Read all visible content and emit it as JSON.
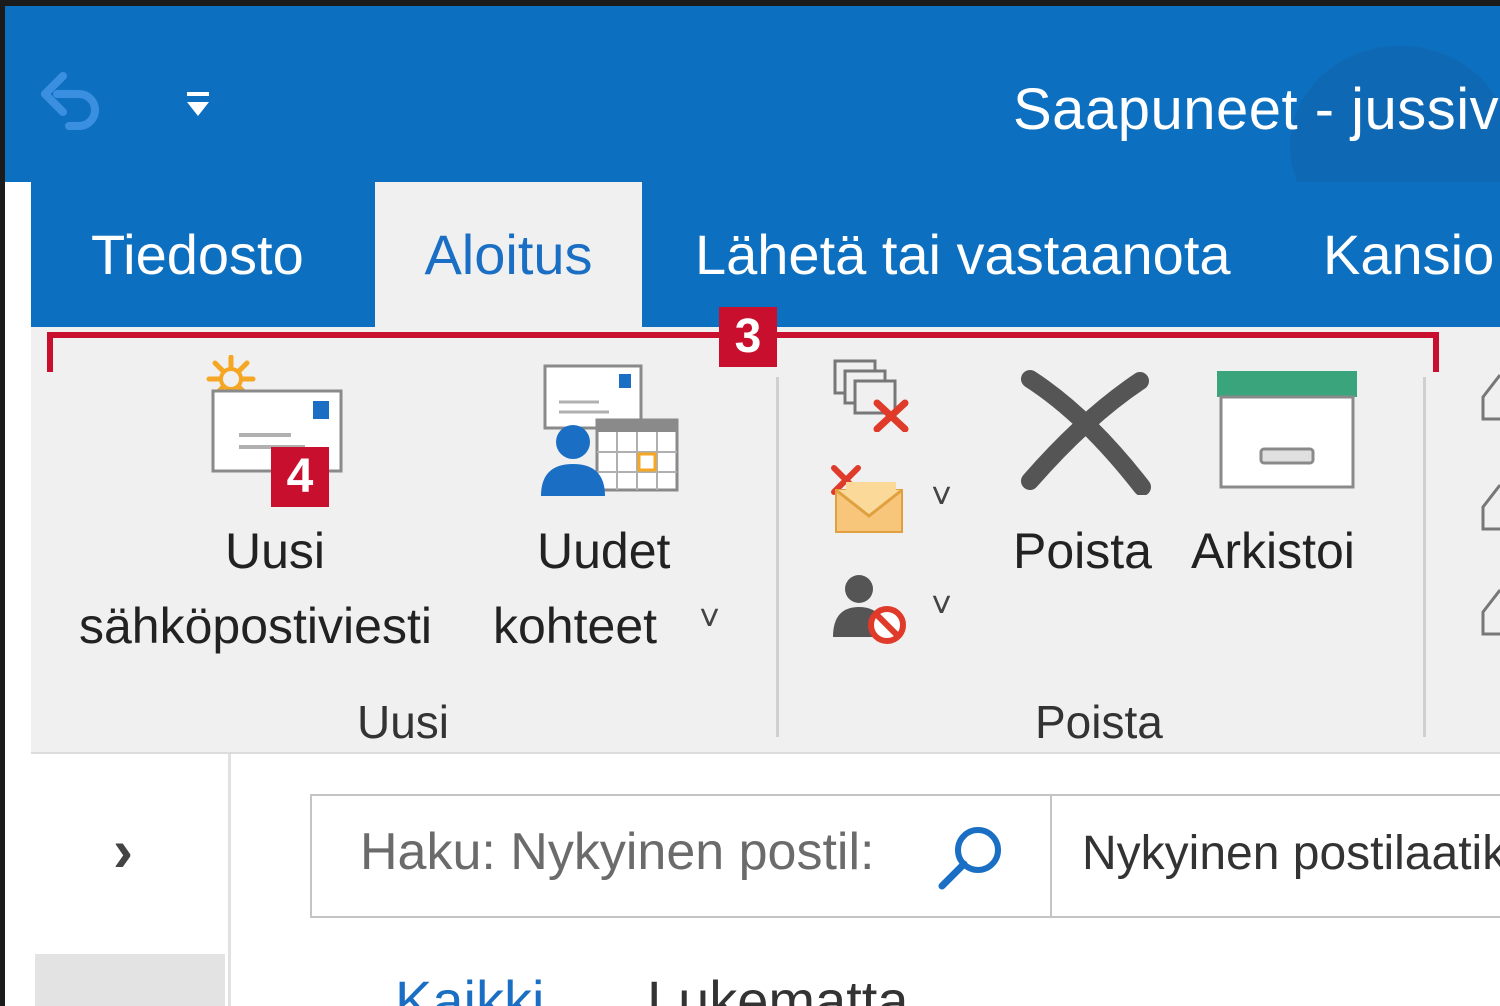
{
  "window": {
    "title": "Saapuneet - jussivir"
  },
  "quick_access": {
    "undo_icon": "undo-icon",
    "customize_icon": "customize-quick-access-icon"
  },
  "tabs": [
    {
      "label": "Tiedosto",
      "active": false
    },
    {
      "label": "Aloitus",
      "active": true
    },
    {
      "label": "Lähetä tai vastaanota",
      "active": false
    },
    {
      "label": "Kansio",
      "active": false
    }
  ],
  "annotations": {
    "bracket_number": "3",
    "new_email_number": "4",
    "accent_color": "#c8102e"
  },
  "ribbon": {
    "groups": {
      "new": {
        "label": "Uusi",
        "new_email": {
          "line1": "Uusi",
          "line2": "sähköpostiviesti"
        },
        "new_items": {
          "line1": "Uudet",
          "line2": "kohteet",
          "dropdown": "˅"
        }
      },
      "delete": {
        "label": "Poista",
        "delete_button": "Poista",
        "archive_button": "Arkistoi",
        "dropdown": "˅"
      }
    }
  },
  "navigation": {
    "expand": "›"
  },
  "search": {
    "placeholder": "Haku: Nykyinen postil:",
    "scope": "Nykyinen postilaatikko"
  },
  "filters": [
    "Kaikki",
    "Lukematta"
  ],
  "colors": {
    "titlebar": "#0d6fbf",
    "active_tab_text": "#1a6fc4",
    "ribbon_bg": "#f0f0f0"
  }
}
